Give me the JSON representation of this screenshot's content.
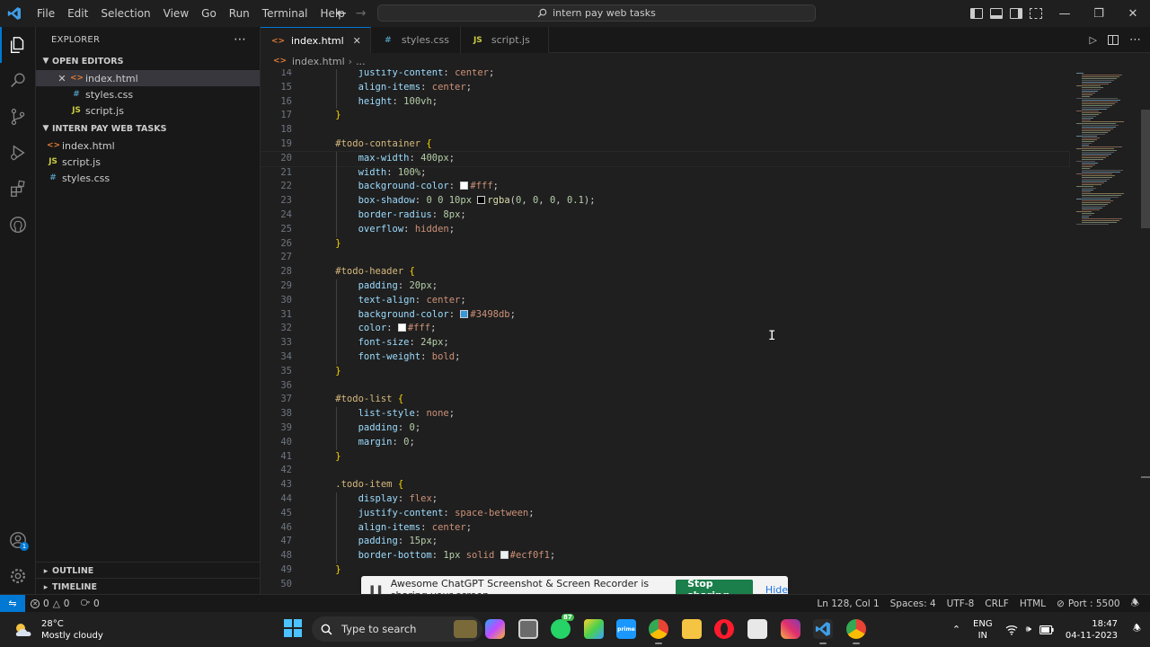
{
  "window": {
    "title": "intern pay web tasks",
    "menu": [
      "File",
      "Edit",
      "Selection",
      "View",
      "Go",
      "Run",
      "Terminal",
      "Help"
    ]
  },
  "sidebar": {
    "header": "EXPLORER",
    "open_editors": {
      "title": "OPEN EDITORS",
      "items": [
        {
          "name": "index.html",
          "type": "html",
          "selected": true
        },
        {
          "name": "styles.css",
          "type": "css"
        },
        {
          "name": "script.js",
          "type": "js"
        }
      ]
    },
    "workspace": {
      "title": "INTERN PAY WEB TASKS",
      "items": [
        {
          "name": "index.html",
          "type": "html"
        },
        {
          "name": "script.js",
          "type": "js"
        },
        {
          "name": "styles.css",
          "type": "css"
        }
      ]
    },
    "outline": "OUTLINE",
    "timeline": "TIMELINE"
  },
  "tabs": [
    {
      "label": "index.html",
      "type": "html",
      "active": true
    },
    {
      "label": "styles.css",
      "type": "css"
    },
    {
      "label": "script.js",
      "type": "js"
    }
  ],
  "breadcrumb": {
    "file": "index.html",
    "rest": "..."
  },
  "code": [
    {
      "n": 14,
      "segs": [
        [
          "p",
          "        justify-content"
        ],
        [
          "u",
          ": "
        ],
        [
          "v",
          "center"
        ],
        [
          "u",
          ";"
        ]
      ]
    },
    {
      "n": 15,
      "segs": [
        [
          "p",
          "        align-items"
        ],
        [
          "u",
          ": "
        ],
        [
          "v",
          "center"
        ],
        [
          "u",
          ";"
        ]
      ]
    },
    {
      "n": 16,
      "segs": [
        [
          "p",
          "        height"
        ],
        [
          "u",
          ": "
        ],
        [
          "n",
          "100vh"
        ],
        [
          "u",
          ";"
        ]
      ]
    },
    {
      "n": 17,
      "segs": [
        [
          "b",
          "    }"
        ]
      ]
    },
    {
      "n": 18,
      "segs": []
    },
    {
      "n": 19,
      "segs": [
        [
          "s",
          "    #todo-container"
        ],
        [
          "b",
          " {"
        ]
      ]
    },
    {
      "n": 20,
      "segs": [
        [
          "p",
          "        max-width"
        ],
        [
          "u",
          ": "
        ],
        [
          "n",
          "400px"
        ],
        [
          "u",
          ";"
        ]
      ],
      "current": true
    },
    {
      "n": 21,
      "segs": [
        [
          "p",
          "        width"
        ],
        [
          "u",
          ": "
        ],
        [
          "n",
          "100%"
        ],
        [
          "u",
          ";"
        ]
      ]
    },
    {
      "n": 22,
      "segs": [
        [
          "p",
          "        background-color"
        ],
        [
          "u",
          ": "
        ],
        [
          "sw",
          "#ffffff"
        ],
        [
          "v",
          "#fff"
        ],
        [
          "u",
          ";"
        ]
      ]
    },
    {
      "n": 23,
      "segs": [
        [
          "p",
          "        box-shadow"
        ],
        [
          "u",
          ": "
        ],
        [
          "n",
          "0 0 10px "
        ],
        [
          "sw",
          "#000000"
        ],
        [
          "f",
          "rgba"
        ],
        [
          "u",
          "("
        ],
        [
          "n",
          "0"
        ],
        [
          "u",
          ", "
        ],
        [
          "n",
          "0"
        ],
        [
          "u",
          ", "
        ],
        [
          "n",
          "0"
        ],
        [
          "u",
          ", "
        ],
        [
          "n",
          "0.1"
        ],
        [
          "u",
          ");"
        ]
      ]
    },
    {
      "n": 24,
      "segs": [
        [
          "p",
          "        border-radius"
        ],
        [
          "u",
          ": "
        ],
        [
          "n",
          "8px"
        ],
        [
          "u",
          ";"
        ]
      ]
    },
    {
      "n": 25,
      "segs": [
        [
          "p",
          "        overflow"
        ],
        [
          "u",
          ": "
        ],
        [
          "v",
          "hidden"
        ],
        [
          "u",
          ";"
        ]
      ]
    },
    {
      "n": 26,
      "segs": [
        [
          "b",
          "    }"
        ]
      ]
    },
    {
      "n": 27,
      "segs": []
    },
    {
      "n": 28,
      "segs": [
        [
          "s",
          "    #todo-header"
        ],
        [
          "b",
          " {"
        ]
      ]
    },
    {
      "n": 29,
      "segs": [
        [
          "p",
          "        padding"
        ],
        [
          "u",
          ": "
        ],
        [
          "n",
          "20px"
        ],
        [
          "u",
          ";"
        ]
      ]
    },
    {
      "n": 30,
      "segs": [
        [
          "p",
          "        text-align"
        ],
        [
          "u",
          ": "
        ],
        [
          "v",
          "center"
        ],
        [
          "u",
          ";"
        ]
      ]
    },
    {
      "n": 31,
      "segs": [
        [
          "p",
          "        background-color"
        ],
        [
          "u",
          ": "
        ],
        [
          "sw",
          "#3498db"
        ],
        [
          "v",
          "#3498db"
        ],
        [
          "u",
          ";"
        ]
      ]
    },
    {
      "n": 32,
      "segs": [
        [
          "p",
          "        color"
        ],
        [
          "u",
          ": "
        ],
        [
          "sw",
          "#ffffff"
        ],
        [
          "v",
          "#fff"
        ],
        [
          "u",
          ";"
        ]
      ]
    },
    {
      "n": 33,
      "segs": [
        [
          "p",
          "        font-size"
        ],
        [
          "u",
          ": "
        ],
        [
          "n",
          "24px"
        ],
        [
          "u",
          ";"
        ]
      ]
    },
    {
      "n": 34,
      "segs": [
        [
          "p",
          "        font-weight"
        ],
        [
          "u",
          ": "
        ],
        [
          "v",
          "bold"
        ],
        [
          "u",
          ";"
        ]
      ]
    },
    {
      "n": 35,
      "segs": [
        [
          "b",
          "    }"
        ]
      ]
    },
    {
      "n": 36,
      "segs": []
    },
    {
      "n": 37,
      "segs": [
        [
          "s",
          "    #todo-list"
        ],
        [
          "b",
          " {"
        ]
      ]
    },
    {
      "n": 38,
      "segs": [
        [
          "p",
          "        list-style"
        ],
        [
          "u",
          ": "
        ],
        [
          "v",
          "none"
        ],
        [
          "u",
          ";"
        ]
      ]
    },
    {
      "n": 39,
      "segs": [
        [
          "p",
          "        padding"
        ],
        [
          "u",
          ": "
        ],
        [
          "n",
          "0"
        ],
        [
          "u",
          ";"
        ]
      ]
    },
    {
      "n": 40,
      "segs": [
        [
          "p",
          "        margin"
        ],
        [
          "u",
          ": "
        ],
        [
          "n",
          "0"
        ],
        [
          "u",
          ";"
        ]
      ]
    },
    {
      "n": 41,
      "segs": [
        [
          "b",
          "    }"
        ]
      ]
    },
    {
      "n": 42,
      "segs": []
    },
    {
      "n": 43,
      "segs": [
        [
          "s",
          "    .todo-item"
        ],
        [
          "b",
          " {"
        ]
      ]
    },
    {
      "n": 44,
      "segs": [
        [
          "p",
          "        display"
        ],
        [
          "u",
          ": "
        ],
        [
          "v",
          "flex"
        ],
        [
          "u",
          ";"
        ]
      ]
    },
    {
      "n": 45,
      "segs": [
        [
          "p",
          "        justify-content"
        ],
        [
          "u",
          ": "
        ],
        [
          "v",
          "space-between"
        ],
        [
          "u",
          ";"
        ]
      ]
    },
    {
      "n": 46,
      "segs": [
        [
          "p",
          "        align-items"
        ],
        [
          "u",
          ": "
        ],
        [
          "v",
          "center"
        ],
        [
          "u",
          ";"
        ]
      ]
    },
    {
      "n": 47,
      "segs": [
        [
          "p",
          "        padding"
        ],
        [
          "u",
          ": "
        ],
        [
          "n",
          "15px"
        ],
        [
          "u",
          ";"
        ]
      ]
    },
    {
      "n": 48,
      "segs": [
        [
          "p",
          "        border-bottom"
        ],
        [
          "u",
          ": "
        ],
        [
          "n",
          "1px "
        ],
        [
          "v",
          "solid "
        ],
        [
          "sw",
          "#ecf0f1"
        ],
        [
          "v",
          "#ecf0f1"
        ],
        [
          "u",
          ";"
        ]
      ]
    },
    {
      "n": 49,
      "segs": [
        [
          "b",
          "    }"
        ]
      ]
    },
    {
      "n": 50,
      "segs": []
    }
  ],
  "share_banner": {
    "message": "Awesome ChatGPT Screenshot & Screen Recorder is sharing your screen.",
    "stop": "Stop sharing",
    "hide": "Hide"
  },
  "statusbar": {
    "errors": "0",
    "warnings": "0",
    "ports_count": "0",
    "position": "Ln 128, Col 1",
    "spaces": "Spaces: 4",
    "encoding": "UTF-8",
    "eol": "CRLF",
    "language": "HTML",
    "port": "Port : 5500"
  },
  "taskbar": {
    "temperature": "28°C",
    "weather": "Mostly cloudy",
    "search_placeholder": "Type to search",
    "whatsapp_badge": "87",
    "lang": "ENG",
    "region": "IN",
    "time": "18:47",
    "date": "04-11-2023"
  },
  "colors": {
    "accent": "#0078d4",
    "editor_bg": "#1f1f1f",
    "stop_sharing": "#1a7f4b"
  }
}
